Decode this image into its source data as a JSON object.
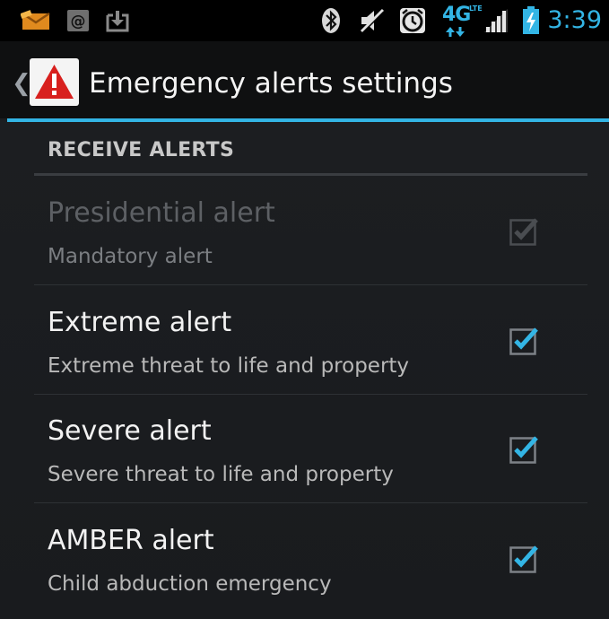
{
  "status_bar": {
    "time": "3:39",
    "network_label": "4G",
    "network_sub_label": "LTE",
    "icons": [
      "mail-icon",
      "email-at-icon",
      "download-icon",
      "bluetooth-icon",
      "vibrate-icon",
      "alarm-clock-icon",
      "signal-icon",
      "battery-charging-icon"
    ],
    "accent_color": "#33b5e5"
  },
  "action_bar": {
    "title": "Emergency alerts settings",
    "up_caret": "❮",
    "app_icon": "warning-triangle-icon"
  },
  "category": {
    "title": "RECEIVE ALERTS"
  },
  "preferences": [
    {
      "title": "Presidential alert",
      "summary": "Mandatory alert",
      "checked": true,
      "enabled": false
    },
    {
      "title": "Extreme alert",
      "summary": "Extreme threat to life and property",
      "checked": true,
      "enabled": true
    },
    {
      "title": "Severe alert",
      "summary": "Severe threat to life and property",
      "checked": true,
      "enabled": true
    },
    {
      "title": "AMBER alert",
      "summary": "Child abduction emergency",
      "checked": true,
      "enabled": true
    }
  ],
  "colors": {
    "accent": "#33b5e5",
    "background": "#1b1d20",
    "disabled_text": "#5d6064"
  }
}
